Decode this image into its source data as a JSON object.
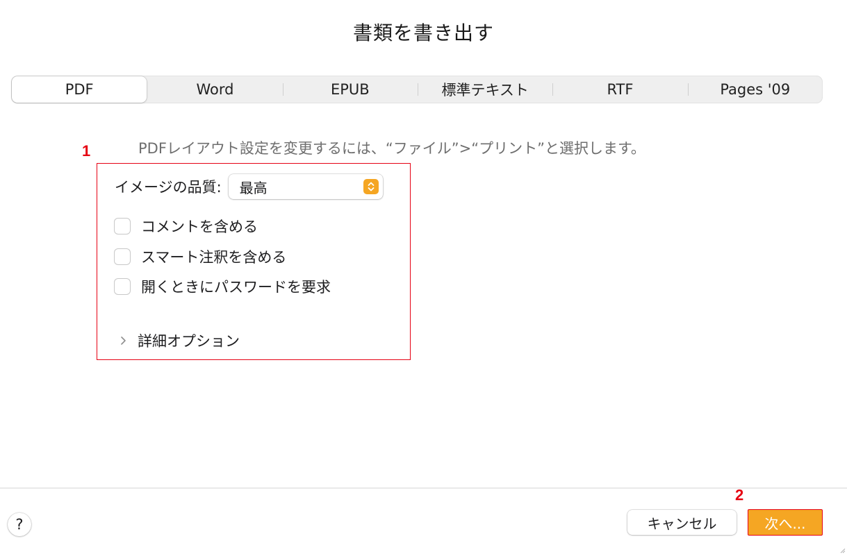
{
  "dialog": {
    "title": "書類を書き出す"
  },
  "tabs": [
    {
      "label": "PDF",
      "selected": true
    },
    {
      "label": "Word",
      "selected": false
    },
    {
      "label": "EPUB",
      "selected": false
    },
    {
      "label": "標準テキスト",
      "selected": false
    },
    {
      "label": "RTF",
      "selected": false
    },
    {
      "label": "Pages '09",
      "selected": false
    }
  ],
  "pdf_panel": {
    "hint": "PDFレイアウト設定を変更するには、“ファイル”>“プリント”と選択します。",
    "image_quality": {
      "label": "イメージの品質:",
      "value": "最高"
    },
    "checkboxes": [
      {
        "label": "コメントを含める",
        "checked": false
      },
      {
        "label": "スマート注釈を含める",
        "checked": false
      },
      {
        "label": "開くときにパスワードを要求",
        "checked": false
      }
    ],
    "advanced_options_label": "詳細オプション"
  },
  "annotations": {
    "marker_1": "1",
    "marker_2": "2",
    "highlight_color": "#e60012"
  },
  "footer": {
    "help_label": "?",
    "cancel_label": "キャンセル",
    "next_label": "次へ..."
  },
  "colors": {
    "accent": "#f5a623",
    "annotation_red": "#e60012"
  },
  "icons": {
    "select_arrow": "chevron-up-down-icon",
    "disclosure": "chevron-right-icon",
    "resize": "resize-grip-icon"
  }
}
